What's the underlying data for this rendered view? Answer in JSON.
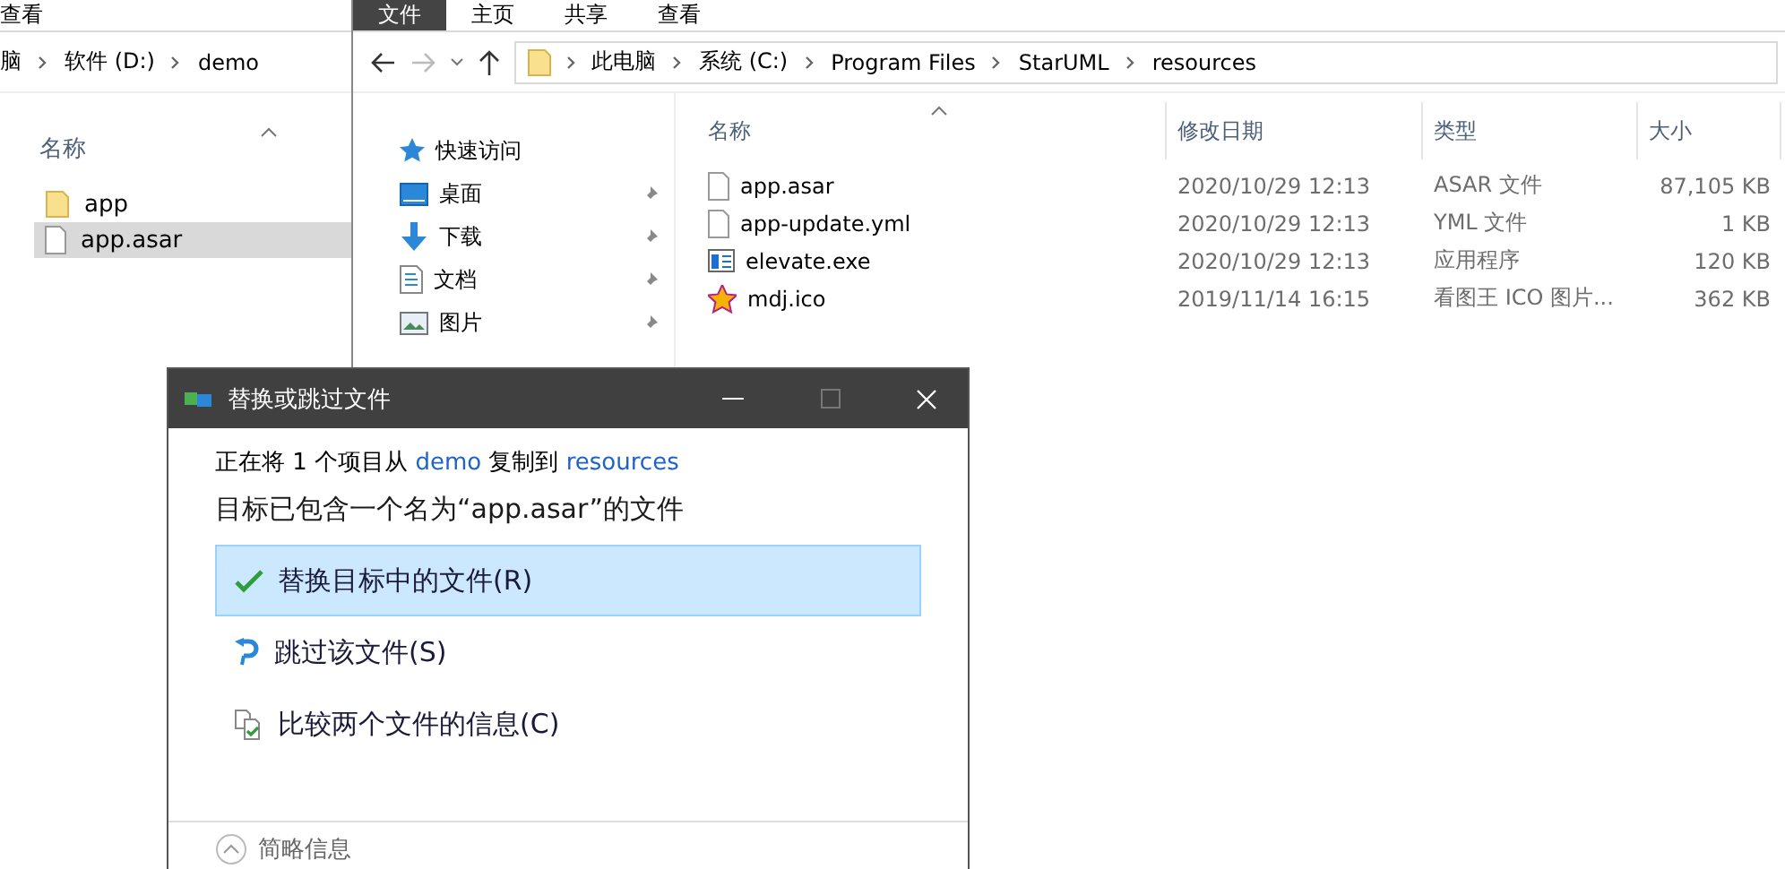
{
  "left_window": {
    "ribbon_tab": "查看",
    "breadcrumb": [
      "脑",
      "软件 (D:)",
      "demo"
    ],
    "column": "名称",
    "items": [
      {
        "name": "app",
        "kind": "folder",
        "selected": false
      },
      {
        "name": "app.asar",
        "kind": "file",
        "selected": true
      }
    ]
  },
  "right_window": {
    "ribbon_tabs": [
      {
        "label": "文件",
        "selected": true
      },
      {
        "label": "主页",
        "selected": false
      },
      {
        "label": "共享",
        "selected": false
      },
      {
        "label": "查看",
        "selected": false
      }
    ],
    "breadcrumb": [
      "此电脑",
      "系统 (C:)",
      "Program Files",
      "StarUML",
      "resources"
    ],
    "navigation": [
      {
        "label": "快速访问",
        "kind": "star",
        "pinned": false
      },
      {
        "label": "桌面",
        "kind": "desktop",
        "pinned": true
      },
      {
        "label": "下载",
        "kind": "download",
        "pinned": true
      },
      {
        "label": "文档",
        "kind": "document",
        "pinned": true
      },
      {
        "label": "图片",
        "kind": "picture",
        "pinned": true
      }
    ],
    "columns": [
      "名称",
      "修改日期",
      "类型",
      "大小"
    ],
    "rows": [
      {
        "name": "app.asar",
        "kind": "file",
        "date": "2020/10/29 12:13",
        "type": "ASAR 文件",
        "size": "87,105 KB"
      },
      {
        "name": "app-update.yml",
        "kind": "file",
        "date": "2020/10/29 12:13",
        "type": "YML 文件",
        "size": "1 KB"
      },
      {
        "name": "elevate.exe",
        "kind": "exe",
        "date": "2020/10/29 12:13",
        "type": "应用程序",
        "size": "120 KB"
      },
      {
        "name": "mdj.ico",
        "kind": "star-ico",
        "date": "2019/11/14 16:15",
        "type": "看图王 ICO 图片...",
        "size": "362 KB"
      }
    ]
  },
  "dialog": {
    "title": "替换或跳过文件",
    "status": {
      "prefix": "正在将 1 个项目从",
      "source": "demo",
      "middle": "复制到",
      "target": "resources"
    },
    "heading": "目标已包含一个名为“app.asar”的文件",
    "options": [
      {
        "kind": "replace",
        "label": "替换目标中的文件(R)",
        "selected": true
      },
      {
        "kind": "skip",
        "label": "跳过该文件(S)",
        "selected": false
      },
      {
        "kind": "compare",
        "label": "比较两个文件的信息(C)",
        "selected": false
      }
    ],
    "details_toggle": "简略信息"
  }
}
